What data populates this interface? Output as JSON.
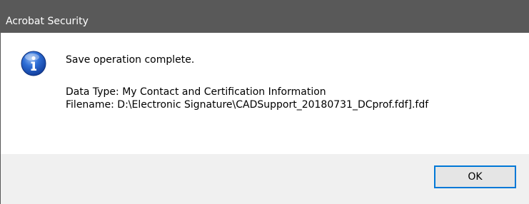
{
  "window": {
    "title": "Acrobat Security"
  },
  "message": {
    "icon": "info-icon",
    "main": "Save operation complete.",
    "data_type": "Data Type: My Contact and Certification Information",
    "filename": "Filename: D:\\Electronic Signature\\CADSupport_20180731_DCprof.fdf].fdf"
  },
  "buttons": {
    "ok_label": "OK"
  },
  "colors": {
    "titlebar": "#595959",
    "accent": "#0078d7",
    "icon_blue": "#1f57c3"
  }
}
